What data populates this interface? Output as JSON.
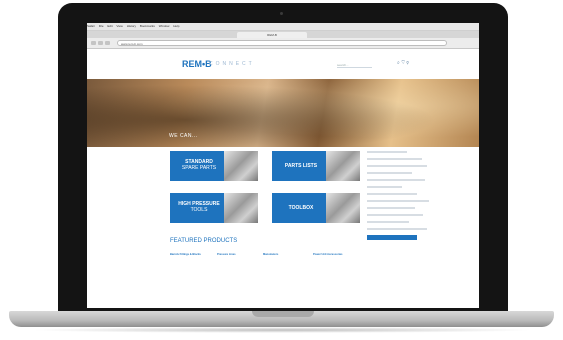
{
  "browser": {
    "menu": [
      "Safari",
      "File",
      "Edit",
      "View",
      "History",
      "Bookmarks",
      "Window",
      "Help"
    ],
    "tab_title": "REM-B",
    "url": "www.rem-b.com"
  },
  "site": {
    "logo": "REM•B",
    "logo_sub": "CONNECT",
    "search_placeholder": "search...",
    "header_icons": "⌕ ♡ ⚲"
  },
  "hero": {
    "text": "WE CAN..."
  },
  "tiles": [
    {
      "line1": "STANDARD",
      "line2": "SPARE PARTS"
    },
    {
      "line1": "PARTS LISTS",
      "line2": ""
    },
    {
      "line1": "HIGH PRESSURE",
      "line2": "TOOLS"
    },
    {
      "line1": "TOOLBOX",
      "line2": ""
    }
  ],
  "featured": {
    "title": "FEATURED PRODUCTS",
    "columns": [
      {
        "heading": "Barrels Fittings & Blocks",
        "items": [
          "",
          "",
          "",
          "",
          "",
          "",
          "",
          ""
        ]
      },
      {
        "heading": "Pressure Lines",
        "items": [
          "",
          "",
          "",
          "",
          "",
          "",
          "",
          ""
        ]
      },
      {
        "heading": "Manometers",
        "items": [
          "",
          "",
          "",
          "",
          "",
          "",
          ""
        ]
      },
      {
        "heading": "Power Unit Accessories",
        "items": [
          "",
          "",
          "",
          "",
          "",
          ""
        ]
      }
    ]
  },
  "sidebar": {
    "items": [
      "",
      "",
      "",
      "",
      "",
      "",
      "",
      ""
    ],
    "button": ""
  },
  "colors": {
    "brand_blue": "#1e73be",
    "laptop_bezel": "#141414",
    "laptop_base": "#c8c8c8"
  }
}
